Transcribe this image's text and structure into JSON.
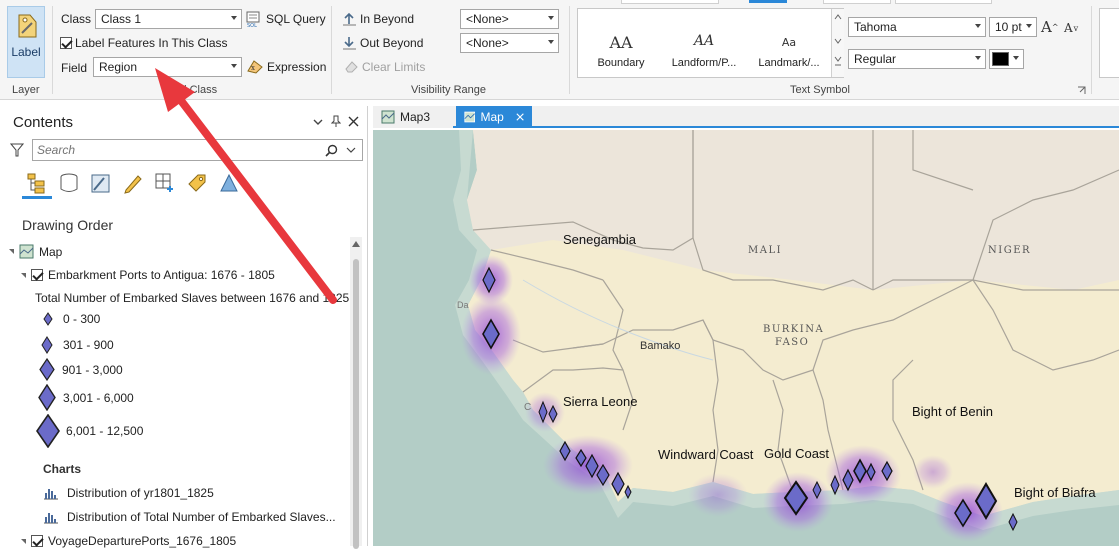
{
  "ribbon": {
    "label_button": "Label",
    "class_label": "Class",
    "class_value": "Class 1",
    "sql_query": "SQL Query",
    "label_features": "Label Features In This Class",
    "field_label": "Field",
    "field_value": "Region",
    "expression": "Expression",
    "in_beyond": "In Beyond",
    "out_beyond": "Out Beyond",
    "clear_limits": "Clear Limits",
    "in_beyond_value": "<None>",
    "out_beyond_value": "<None>",
    "symbols": [
      {
        "glyph": "AA",
        "name": "Boundary"
      },
      {
        "glyph": "AA",
        "name": "Landform/P..."
      },
      {
        "glyph": "Aa",
        "name": "Landmark/..."
      }
    ],
    "font_name": "Tahoma",
    "font_size": "10 pt",
    "font_style": "Regular",
    "grow_font": "A",
    "shrink_font": "A",
    "group_layer": "Layer",
    "group_label_class": "Label Class",
    "group_label_class_visible": "el Class",
    "group_visibility": "Visibility Range",
    "group_text_symbol": "Text Symbol",
    "colors": {
      "accent": "#2b88d8",
      "arrow": "#e8383d",
      "symbol_fill": "#6b6bc9"
    }
  },
  "contents": {
    "title": "Contents",
    "search_placeholder": "Search",
    "section": "Drawing Order",
    "map_item": "Map",
    "layer1": "Embarkment Ports to Antigua: 1676 - 1805",
    "layer1_field": "Total Number of Embarked Slaves between 1676 and 1825",
    "legend": [
      "0 - 300",
      "301 - 900",
      "901 - 3,000",
      "3,001 - 6,000",
      "6,001 - 12,500"
    ],
    "charts_label": "Charts",
    "charts": [
      "Distribution of yr1801_1825",
      "Distribution of Total Number of Embarked Slaves..."
    ],
    "layer2": "VoyageDeparturePorts_1676_1805"
  },
  "tabs": [
    {
      "label": "Map3",
      "active": false
    },
    {
      "label": "Map",
      "active": true
    }
  ],
  "map": {
    "regions": [
      "Senegambia",
      "Sierra Leone",
      "Windward Coast",
      "Gold Coast",
      "Bight of Benin",
      "Bight of Biafra"
    ],
    "countries": [
      "MALI",
      "NIGER",
      "BURKINA",
      "FASO"
    ],
    "cities": [
      "Bamako",
      "Da",
      "C"
    ]
  }
}
